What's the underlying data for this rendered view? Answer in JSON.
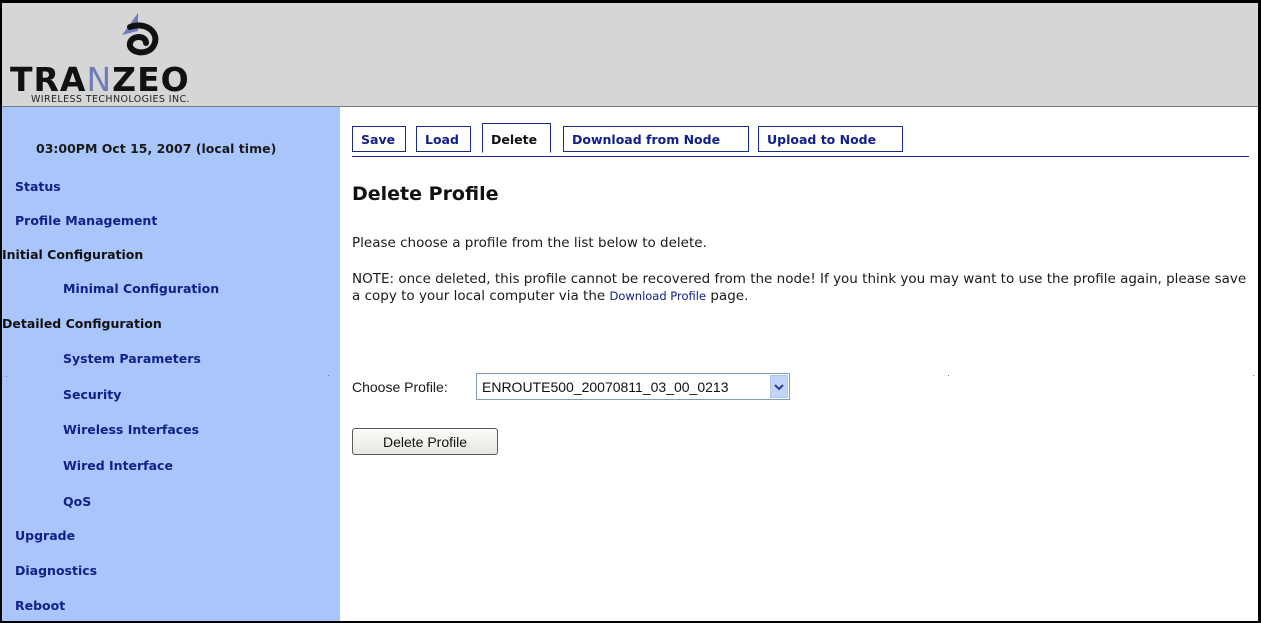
{
  "header": {
    "brand_left": "TRA",
    "brand_mid": "N",
    "brand_right": "ZEO",
    "tagline": "WIRELESS TECHNOLOGIES INC.",
    "logo_icon": "tranzeo-swirl-icon"
  },
  "sidebar": {
    "timestamp": "03:00PM Oct 15, 2007 (local time)",
    "items": [
      {
        "label": "Status"
      },
      {
        "label": "Profile Management"
      },
      {
        "label": "Initial Configuration"
      },
      {
        "label": "Minimal Configuration"
      },
      {
        "label": "Detailed Configuration"
      },
      {
        "label": "System Parameters"
      },
      {
        "label": "Security"
      },
      {
        "label": "Wireless Interfaces"
      },
      {
        "label": "Wired Interface"
      },
      {
        "label": "QoS"
      },
      {
        "label": "Upgrade"
      },
      {
        "label": "Diagnostics"
      },
      {
        "label": "Reboot"
      }
    ]
  },
  "tabs": [
    {
      "label": "Save"
    },
    {
      "label": "Load"
    },
    {
      "label": "Delete"
    },
    {
      "label": "Download from Node"
    },
    {
      "label": "Upload to Node"
    }
  ],
  "content": {
    "title": "Delete Profile",
    "intro": "Please choose a profile from the list below to delete.",
    "note_before": "NOTE: once deleted, this profile cannot be recovered from the node! If you think you may want to use the profile again, please save a copy to your local computer via the ",
    "note_link": "Download Profile",
    "note_after": " page.",
    "choose_label": "Choose Profile:",
    "selected_profile": "ENROUTE500_20070811_03_00_0213",
    "delete_button": "Delete Profile"
  },
  "colors": {
    "sidebar_bg": "#a9c6fc",
    "header_bg": "#d6d6d6",
    "link": "#12208a"
  }
}
